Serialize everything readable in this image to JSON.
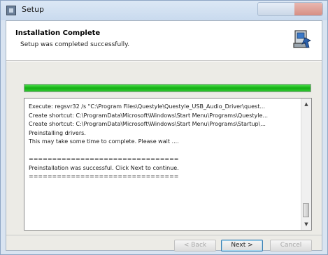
{
  "window": {
    "title": "Setup"
  },
  "header": {
    "title": "Installation Complete",
    "subtitle": "Setup was completed successfully."
  },
  "progress": {
    "percent": 100,
    "color": "#1fbf1f"
  },
  "log": {
    "lines": [
      "Execute: regsvr32 /s \"C:\\Program Files\\Questyle\\Questyle_USB_Audio_Driver\\quest...",
      "Create shortcut: C:\\ProgramData\\Microsoft\\Windows\\Start Menu\\Programs\\Questyle...",
      "Create shortcut: C:\\ProgramData\\Microsoft\\Windows\\Start Menu\\Programs\\Startup\\...",
      "Preinstalling drivers.",
      "This may take some time to complete. Please wait ....",
      "",
      "================================",
      "Preinstallation was successful. Click Next to continue.",
      "================================"
    ]
  },
  "buttons": {
    "back": "< Back",
    "next": "Next >",
    "cancel": "Cancel"
  },
  "icons": {
    "title": "setup-app-icon",
    "header": "installer-computer-icon",
    "scroll_up": "arrow-up-icon",
    "scroll_down": "arrow-down-icon"
  }
}
